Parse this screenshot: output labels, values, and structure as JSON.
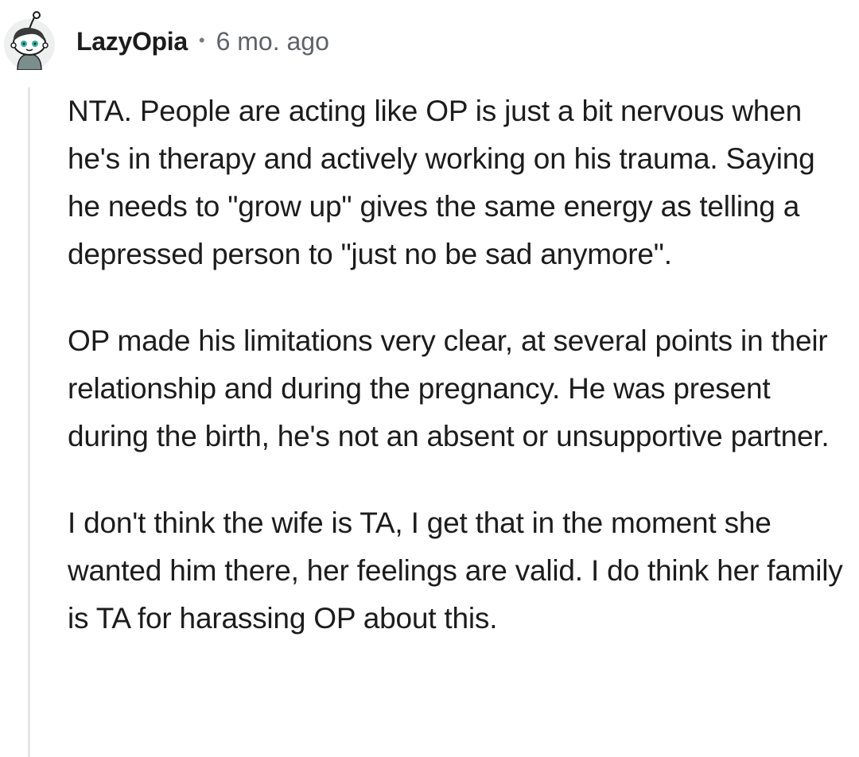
{
  "comment": {
    "author": "LazyOpia",
    "separator": "•",
    "timestamp": "6 mo. ago",
    "avatar_icon": "reddit-snoo-avatar-icon",
    "paragraphs": [
      "NTA. People are acting like OP is just a bit nervous when he's in therapy and actively working on his trauma. Saying he needs to \"grow up\" gives the same energy as telling a depressed person to \"just no be sad anymore\".",
      "OP made his limitations very clear, at several points in their relationship and during the pregnancy. He was present during the birth, he's not an absent or unsupportive partner.",
      "I don't think the wife is TA, I get that in the moment she wanted him there, her feelings are valid. I do think her family is TA for harassing OP about this."
    ]
  },
  "colors": {
    "text": "#1c1c1c",
    "meta": "#5f6368",
    "thread_line": "#e6e6e6",
    "avatar_teal": "#2fb8a6"
  }
}
